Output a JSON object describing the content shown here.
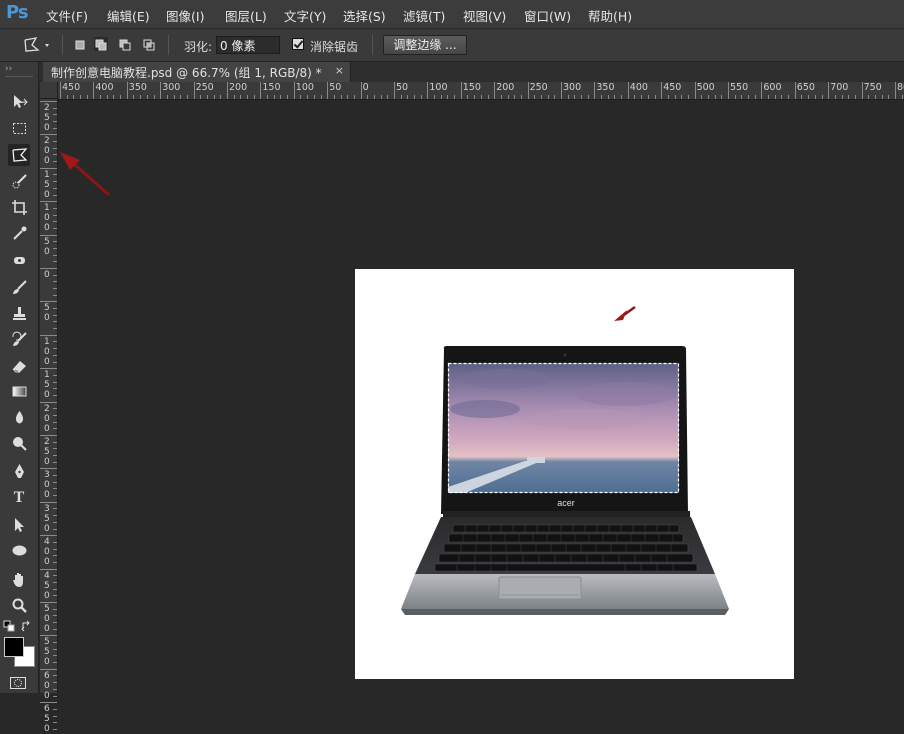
{
  "app": {
    "logo": "Ps"
  },
  "menu": [
    "文件(F)",
    "编辑(E)",
    "图像(I)",
    "图层(L)",
    "文字(Y)",
    "选择(S)",
    "滤镜(T)",
    "视图(V)",
    "窗口(W)",
    "帮助(H)"
  ],
  "options": {
    "feather_label": "羽化:",
    "feather_value": "0 像素",
    "antialias_label": "消除锯齿",
    "antialias_checked": true,
    "refine_edge_label": "调整边缘 ..."
  },
  "document": {
    "tab_title": "制作创意电脑教程.psd @ 66.7% (组 1, RGB/8) *",
    "close_glyph": "×"
  },
  "rulers": {
    "horizontal": [
      "450",
      "400",
      "350",
      "300",
      "250",
      "200",
      "150",
      "100",
      "50",
      "0",
      "50",
      "100",
      "150",
      "200",
      "250",
      "300",
      "350",
      "400",
      "450",
      "500",
      "550",
      "600",
      "650",
      "700",
      "750",
      "80"
    ],
    "vertical": [
      "2 5 0",
      "2 0 0",
      "1 5 0",
      "1 0 0",
      "5 0",
      "0",
      "5 0",
      "1 0 0",
      "1 5 0",
      "2 0 0",
      "2 5 0",
      "3 0 0",
      "3 5 0",
      "4 0 0",
      "4 5 0",
      "5 0 0",
      "5 5 0",
      "6 0 0",
      "6 5 0"
    ]
  },
  "tools": [
    "move-tool",
    "marquee-tool",
    "polygonal-lasso-tool",
    "quick-selection-tool",
    "crop-tool",
    "eyedropper-tool",
    "spot-healing-tool",
    "brush-tool",
    "clone-stamp-tool",
    "history-brush-tool",
    "eraser-tool",
    "gradient-tool",
    "blur-tool",
    "dodge-tool",
    "pen-tool",
    "type-tool",
    "path-selection-tool",
    "ellipse-tool",
    "hand-tool",
    "zoom-tool"
  ],
  "type_tool_glyph": "T",
  "laptop": {
    "brand": "acer"
  },
  "colors": {
    "accent_arrow": "#a01818",
    "ps_blue": "#4b97d6",
    "foreground": "#000000",
    "background": "#ffffff"
  }
}
